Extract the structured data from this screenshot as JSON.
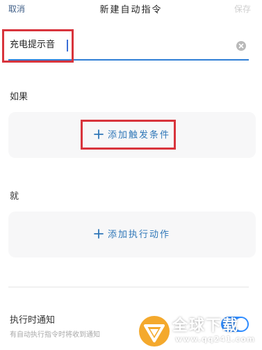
{
  "header": {
    "cancel_label": "取消",
    "title": "新建自动指令",
    "save_label": "保存"
  },
  "name_field": {
    "value": "充电提示音"
  },
  "if_section": {
    "label": "如果",
    "add_label": "添加触发条件"
  },
  "then_section": {
    "label": "就",
    "add_label": "添加执行动作"
  },
  "notification": {
    "title": "执行时通知",
    "description": "有自动执行指令时将收到通知",
    "enabled": true
  },
  "watermark": {
    "brand": "全球下载",
    "url": "www.qq241.com"
  },
  "colors": {
    "accent": "#2f77b8",
    "highlight": "#d8343c",
    "toggle_on": "#2f8cff",
    "watermark": "#f3a21b"
  }
}
